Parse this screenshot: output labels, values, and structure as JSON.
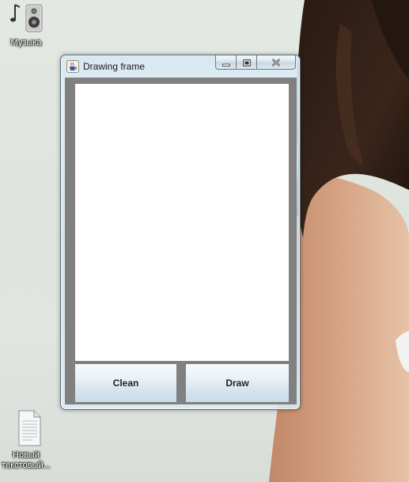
{
  "desktop": {
    "icons": [
      {
        "label": "Музыка",
        "icon": "speaker-music-icon"
      },
      {
        "label": "Новый текстовый...",
        "icon": "text-document-icon"
      }
    ]
  },
  "window": {
    "title": "Drawing frame",
    "app_icon": "java-cup-icon",
    "caption_buttons": [
      "minimize",
      "maximize",
      "close"
    ]
  },
  "buttons": {
    "clean_label": "Clean",
    "draw_label": "Draw"
  },
  "colors": {
    "client_background": "#808080",
    "canvas_background": "#ffffff"
  }
}
